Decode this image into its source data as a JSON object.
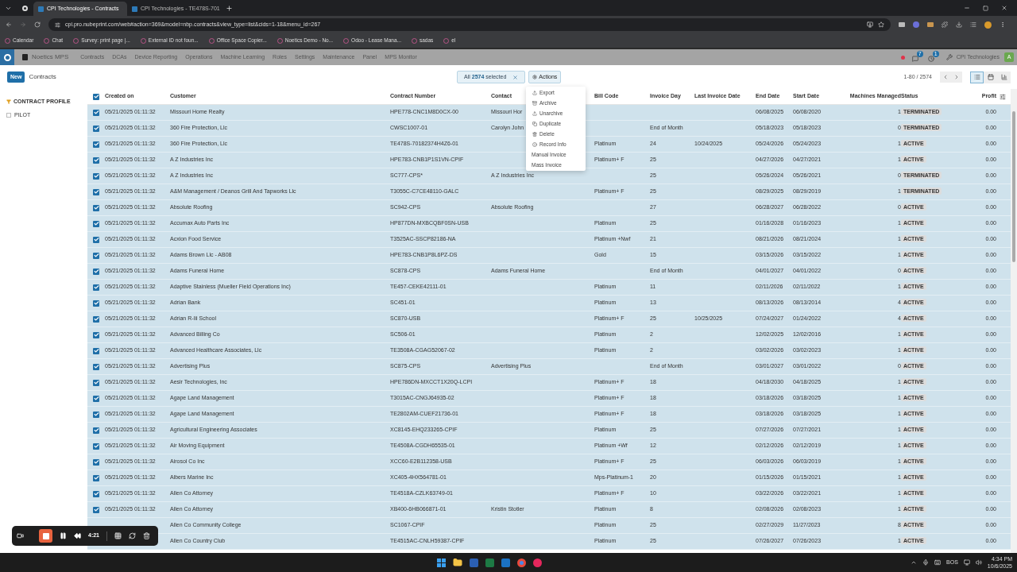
{
  "browser": {
    "tabs": [
      {
        "title": "CPI Technologies - Contracts",
        "selected": true
      },
      {
        "title": "CPI Technologies - TE478S-701",
        "selected": false
      }
    ],
    "url": "cpi.pro.nubeprint.com/web#action=369&model=nbp.contracts&view_type=list&cids=1-18&menu_id=267",
    "bookmarks": [
      "Calendar",
      "Chat",
      "Survey: print page |...",
      "External ID not foun...",
      "Office Space Copier...",
      "Noetics Demo - No...",
      "Odoo - Lease Mana...",
      "sadas",
      "el"
    ]
  },
  "navbar": {
    "app_name": "Noetics MPS",
    "menu": [
      "Contracts",
      "DCAs",
      "Device Reporting",
      "Operations",
      "Machine Learning",
      "Roles",
      "Settings",
      "Maintenance",
      "Panel",
      "MPS Monitor"
    ],
    "messages_count": "7",
    "activities_count": "1",
    "company": "CPI Technologies",
    "avatar": "A"
  },
  "control_bar": {
    "new_button": "New",
    "breadcrumb": "Contracts",
    "selection": "All **2574** selected",
    "actions_button": "Actions",
    "pager": "1-80 / 2574",
    "views": [
      {
        "kind": "list",
        "selected": true
      },
      {
        "kind": "calendar",
        "selected": false
      },
      {
        "kind": "graph",
        "selected": false
      }
    ]
  },
  "actions_menu": [
    {
      "kind": "export",
      "label": "Export"
    },
    {
      "kind": "archive",
      "label": "Archive"
    },
    {
      "kind": "unarchive",
      "label": "Unarchive"
    },
    {
      "kind": "duplicate",
      "label": "Duplicate"
    },
    {
      "kind": "delete",
      "label": "Delete"
    },
    {
      "kind": "info",
      "label": "Record Info"
    },
    {
      "kind": "plain",
      "label": "Manual Invoice"
    },
    {
      "kind": "plain",
      "label": "Mass Invoice"
    }
  ],
  "sidebar": {
    "heading": "CONTRACT PROFILE",
    "items": [
      {
        "label": "PILOT",
        "checked": false
      }
    ]
  },
  "table": {
    "all_checked": true,
    "columns": [
      "Created on",
      "Customer",
      "Contract Number",
      "Contact",
      "Bill Code",
      "Invoice Day",
      "Last Invoice Date",
      "End Date",
      "Start Date",
      "Machines Managed",
      "Status",
      "Profit"
    ],
    "rows": [
      {
        "checked": true,
        "created": "05/21/2025 01:11:32",
        "customer": "Missouri Home Realty",
        "contract": "HPE778-CNC1M8D0CX-00",
        "contact": "Missouri Hor",
        "end": "06/08/2025",
        "start": "06/08/2020",
        "machines": "1",
        "status": "TERMINATED",
        "profit": "0.00"
      },
      {
        "checked": true,
        "created": "05/21/2025 01:11:32",
        "customer": "360 Fire Protection, Llc",
        "contract": "CWSC1007-01",
        "contact": "Carolyn John",
        "invoice_day": "End of Month",
        "end": "05/18/2023",
        "start": "05/18/2023",
        "machines": "0",
        "status": "TERMINATED",
        "profit": "0.00"
      },
      {
        "checked": true,
        "created": "05/21/2025 01:11:32",
        "customer": "360 Fire Protection, Llc",
        "contract": "TE478S-70182374H4Z6-01",
        "bill": "Platinum",
        "invoice_day": "24",
        "last_invoice": "10/24/2025",
        "end": "05/24/2026",
        "start": "05/24/2023",
        "machines": "1",
        "status": "ACTIVE",
        "profit": "0.00"
      },
      {
        "checked": true,
        "created": "05/21/2025 01:11:32",
        "customer": "A Z Industries Inc",
        "contract": "HPE783-CNB1P1S1VN-CPIF",
        "bill": "Platinum+ F",
        "invoice_day": "25",
        "end": "04/27/2026",
        "start": "04/27/2021",
        "machines": "1",
        "status": "ACTIVE",
        "profit": "0.00"
      },
      {
        "checked": true,
        "created": "05/21/2025 01:11:32",
        "customer": "A Z Industries Inc",
        "contract": "SC777-CPS*",
        "contact": "A Z Industries Inc",
        "invoice_day": "25",
        "end": "05/26/2024",
        "start": "05/26/2021",
        "machines": "0",
        "status": "TERMINATED",
        "profit": "0.00"
      },
      {
        "checked": true,
        "created": "05/21/2025 01:11:32",
        "customer": "A&M Management / Deanos Grill And Tapworks Llc",
        "contract": "T3055C-C7CE48110-GALC",
        "bill": "Platinum+ F",
        "invoice_day": "25",
        "end": "08/29/2025",
        "start": "08/29/2019",
        "machines": "1",
        "status": "TERMINATED",
        "profit": "0.00"
      },
      {
        "checked": true,
        "created": "05/21/2025 01:11:32",
        "customer": "Absolute Roofing",
        "contract": "SC942-CPS",
        "contact": "Absolute Roofing",
        "invoice_day": "27",
        "end": "06/28/2027",
        "start": "06/28/2022",
        "machines": "0",
        "status": "ACTIVE",
        "profit": "0.00"
      },
      {
        "checked": true,
        "created": "05/21/2025 01:11:32",
        "customer": "Accumax Auto Parts Inc",
        "contract": "HP877DN-MXBCQBF0SN-USB",
        "bill": "Platinum",
        "invoice_day": "25",
        "end": "01/16/2028",
        "start": "01/16/2023",
        "machines": "1",
        "status": "ACTIVE",
        "profit": "0.00"
      },
      {
        "checked": true,
        "created": "05/21/2025 01:11:32",
        "customer": "Acxion Food Service",
        "contract": "T3525AC-SSCP82186-NA",
        "bill": "Platinum +Nwf",
        "invoice_day": "21",
        "end": "08/21/2026",
        "start": "08/21/2024",
        "machines": "1",
        "status": "ACTIVE",
        "profit": "0.00"
      },
      {
        "checked": true,
        "created": "05/21/2025 01:11:32",
        "customer": "Adams Brown Llc - AB08",
        "contract": "HPE783-CNB1P8L6PZ-DS",
        "bill": "Gold",
        "invoice_day": "15",
        "end": "03/15/2026",
        "start": "03/15/2022",
        "machines": "1",
        "status": "ACTIVE",
        "profit": "0.00"
      },
      {
        "checked": true,
        "created": "05/21/2025 01:11:32",
        "customer": "Adams Funeral Home",
        "contract": "SC878-CPS",
        "contact": "Adams Funeral Home",
        "invoice_day": "End of Month",
        "end": "04/01/2027",
        "start": "04/01/2022",
        "machines": "0",
        "status": "ACTIVE",
        "profit": "0.00"
      },
      {
        "checked": true,
        "created": "05/21/2025 01:11:32",
        "customer": "Adaptive Stainless (Mueller Field Operations Inc)",
        "contract": "TE457-CEKE42111-01",
        "bill": "Platinum",
        "invoice_day": "11",
        "end": "02/11/2026",
        "start": "02/11/2022",
        "machines": "1",
        "status": "ACTIVE",
        "profit": "0.00"
      },
      {
        "checked": true,
        "created": "05/21/2025 01:11:32",
        "customer": "Adrian Bank",
        "contract": "SC451-01",
        "bill": "Platinum",
        "invoice_day": "13",
        "end": "08/13/2026",
        "start": "08/13/2014",
        "machines": "4",
        "status": "ACTIVE",
        "profit": "0.00"
      },
      {
        "checked": true,
        "created": "05/21/2025 01:11:32",
        "customer": "Adrian R-Iii School",
        "contract": "SC870-USB",
        "bill": "Platinum+ F",
        "invoice_day": "25",
        "last_invoice": "10/25/2025",
        "end": "07/24/2027",
        "start": "01/24/2022",
        "machines": "4",
        "status": "ACTIVE",
        "profit": "0.00"
      },
      {
        "checked": true,
        "created": "05/21/2025 01:11:32",
        "customer": "Advanced Billing Co",
        "contract": "SC506-01",
        "bill": "Platinum",
        "invoice_day": "2",
        "end": "12/02/2025",
        "start": "12/02/2016",
        "machines": "1",
        "status": "ACTIVE",
        "profit": "0.00"
      },
      {
        "checked": true,
        "created": "05/21/2025 01:11:32",
        "customer": "Advanced Healthcare Associates, Llc",
        "contract": "TE3508A-CGAG52067-02",
        "bill": "Platinum",
        "invoice_day": "2",
        "end": "03/02/2026",
        "start": "03/02/2023",
        "machines": "1",
        "status": "ACTIVE",
        "profit": "0.00"
      },
      {
        "checked": true,
        "created": "05/21/2025 01:11:32",
        "customer": "Advertising Plus",
        "contract": "SC875-CPS",
        "contact": "Advertising Plus",
        "invoice_day": "End of Month",
        "end": "03/01/2027",
        "start": "03/01/2022",
        "machines": "0",
        "status": "ACTIVE",
        "profit": "0.00"
      },
      {
        "checked": true,
        "created": "05/21/2025 01:11:32",
        "customer": "Aesir Technologies, Inc",
        "contract": "HPE786DN-MXCCT1X20Q-LCPI",
        "bill": "Platinum+ F",
        "invoice_day": "18",
        "end": "04/18/2030",
        "start": "04/18/2025",
        "machines": "1",
        "status": "ACTIVE",
        "profit": "0.00"
      },
      {
        "checked": true,
        "created": "05/21/2025 01:11:32",
        "customer": "Agape Land Management",
        "contract": "T3015AC-CNGJ64935-02",
        "bill": "Platinum+ F",
        "invoice_day": "18",
        "end": "03/18/2026",
        "start": "03/18/2025",
        "machines": "1",
        "status": "ACTIVE",
        "profit": "0.00"
      },
      {
        "checked": true,
        "created": "05/21/2025 01:11:32",
        "customer": "Agape Land Management",
        "contract": "TE2802AM-CUEF21736-01",
        "bill": "Platinum+ F",
        "invoice_day": "18",
        "end": "03/18/2026",
        "start": "03/18/2025",
        "machines": "1",
        "status": "ACTIVE",
        "profit": "0.00"
      },
      {
        "checked": true,
        "created": "05/21/2025 01:11:32",
        "customer": "Agricultural Engineering Associates",
        "contract": "XC8145-EHQ233265-CPIF",
        "bill": "Platinum",
        "invoice_day": "25",
        "end": "07/27/2026",
        "start": "07/27/2021",
        "machines": "1",
        "status": "ACTIVE",
        "profit": "0.00"
      },
      {
        "checked": true,
        "created": "05/21/2025 01:11:32",
        "customer": "Air Moving Equipment",
        "contract": "TE4508A-CGDH65535-01",
        "bill": "Platinum +Wf",
        "invoice_day": "12",
        "end": "02/12/2026",
        "start": "02/12/2019",
        "machines": "1",
        "status": "ACTIVE",
        "profit": "0.00"
      },
      {
        "checked": true,
        "created": "05/21/2025 01:11:32",
        "customer": "Airosol Co Inc",
        "contract": "XCC60-E2B112358-USB",
        "bill": "Platinum+ F",
        "invoice_day": "25",
        "end": "06/03/2026",
        "start": "06/03/2019",
        "machines": "1",
        "status": "ACTIVE",
        "profit": "0.00"
      },
      {
        "checked": true,
        "created": "05/21/2025 01:11:32",
        "customer": "Albers Marine Inc",
        "contract": "XC405-4HX564781-01",
        "bill": "Mps-Platinum-1",
        "invoice_day": "20",
        "end": "01/15/2026",
        "start": "01/15/2021",
        "machines": "1",
        "status": "ACTIVE",
        "profit": "0.00"
      },
      {
        "checked": true,
        "created": "05/21/2025 01:11:32",
        "customer": "Allen Co Attorney",
        "contract": "TE4518A-CZLK63749-01",
        "bill": "Platinum+ F",
        "invoice_day": "10",
        "end": "03/22/2026",
        "start": "03/22/2021",
        "machines": "1",
        "status": "ACTIVE",
        "profit": "0.00"
      },
      {
        "checked": true,
        "created": "05/21/2025 01:11:32",
        "customer": "Allen Co Attorney",
        "contract": "XB400-6HB066871-01",
        "contact": "Kristin Stotler",
        "bill": "Platinum",
        "invoice_day": "8",
        "end": "02/08/2026",
        "start": "02/08/2023",
        "machines": "1",
        "status": "ACTIVE",
        "profit": "0.00"
      },
      {
        "customer": "Allen Co Community College",
        "contract": "SC1067-CPIF",
        "bill": "Platinum",
        "invoice_day": "25",
        "end": "02/27/2029",
        "start": "11/27/2023",
        "machines": "8",
        "status": "ACTIVE",
        "profit": "0.00"
      },
      {
        "customer": "Allen Co Country Club",
        "contract": "TE4515AC-CNLH59387-CPIF",
        "bill": "Platinum",
        "invoice_day": "25",
        "end": "07/26/2027",
        "start": "07/26/2023",
        "machines": "1",
        "status": "ACTIVE",
        "profit": "0.00"
      }
    ]
  },
  "recorder": {
    "time": "4:21"
  },
  "taskbar": {
    "language": "BOS",
    "time": "4:34 PM",
    "date": "10/6/2025"
  }
}
